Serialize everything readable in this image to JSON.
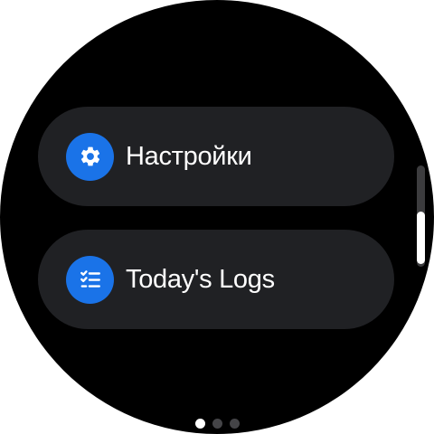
{
  "menu": {
    "items": [
      {
        "label": "Настройки",
        "icon": "gear-icon"
      },
      {
        "label": "Today's Logs",
        "icon": "checklist-icon"
      }
    ]
  },
  "scrollbar": {
    "position": 0.95,
    "visible_fraction": 0.52
  },
  "pager": {
    "count": 3,
    "active_index": 0
  },
  "colors": {
    "background": "#000000",
    "chip": "#202124",
    "icon_accent": "#1a73e8",
    "text": "#ffffff"
  }
}
